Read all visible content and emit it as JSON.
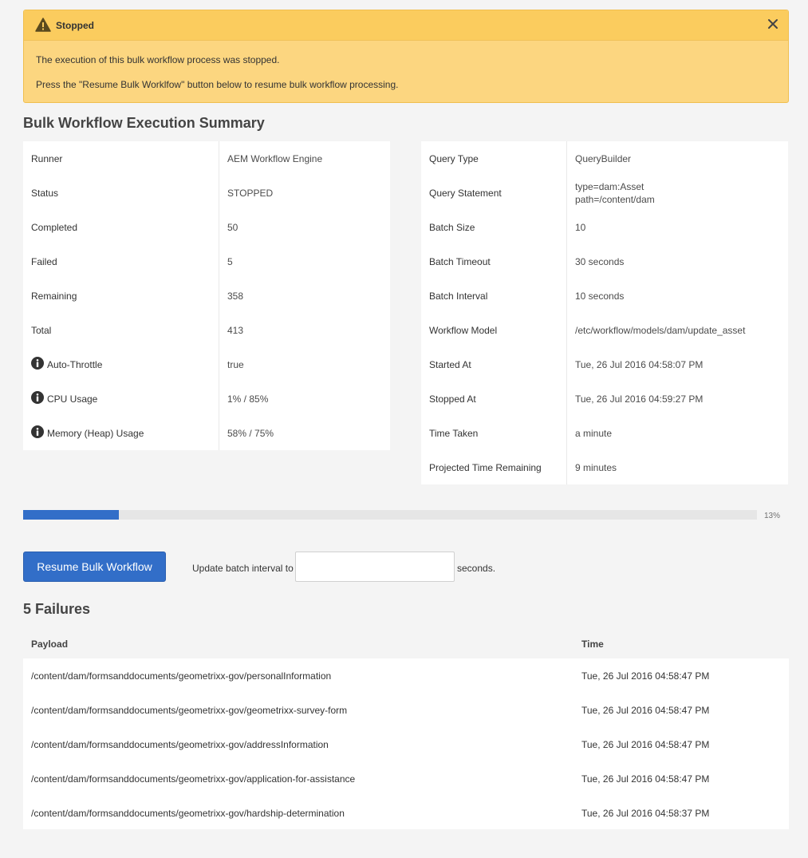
{
  "alert": {
    "title": "Stopped",
    "message1": "The execution of this bulk workflow process was stopped.",
    "message2": "Press the \"Resume Bulk Worklfow\" button below to resume bulk workflow processing.",
    "icon": "warning-icon",
    "close_icon": "close-icon"
  },
  "summary": {
    "heading": "Bulk Workflow Execution Summary",
    "left": [
      {
        "label": "Runner",
        "value": "AEM Workflow Engine"
      },
      {
        "label": "Status",
        "value": "STOPPED"
      },
      {
        "label": "Completed",
        "value": "50"
      },
      {
        "label": "Failed",
        "value": "5"
      },
      {
        "label": "Remaining",
        "value": "358"
      },
      {
        "label": "Total",
        "value": "413"
      },
      {
        "label": "Auto-Throttle",
        "value": "true"
      },
      {
        "label": "CPU Usage",
        "value": "1% / 85%"
      },
      {
        "label": "Memory (Heap) Usage",
        "value": "58% / 75%"
      }
    ],
    "right": [
      {
        "label": "Query Type",
        "value": "QueryBuilder"
      },
      {
        "label": "Query Statement",
        "value": "type=dam:Asset",
        "value2": "path=/content/dam"
      },
      {
        "label": "Batch Size",
        "value": "10"
      },
      {
        "label": "Batch Timeout",
        "value": "30 seconds"
      },
      {
        "label": "Batch Interval",
        "value": "10 seconds"
      },
      {
        "label": "Workflow Model",
        "value": "/etc/workflow/models/dam/update_asset"
      },
      {
        "label": "Started At",
        "value": "Tue, 26 Jul 2016 04:58:07 PM"
      },
      {
        "label": "Stopped At",
        "value": "Tue, 26 Jul 2016 04:59:27 PM"
      },
      {
        "label": "Time Taken",
        "value": "a minute"
      },
      {
        "label": "Projected Time Remaining",
        "value": "9 minutes"
      }
    ]
  },
  "progress": {
    "percent_label": "13%",
    "fraction": 0.13,
    "color": "#326ec8"
  },
  "controls": {
    "resume_button": "Resume Bulk Workflow",
    "interval_label": "Update batch interval to",
    "interval_value": "",
    "interval_suffix": "seconds."
  },
  "failures": {
    "heading": "5 Failures",
    "columns": {
      "payload": "Payload",
      "time": "Time"
    },
    "rows": [
      {
        "payload": "/content/dam/formsanddocuments/geometrixx-gov/personalInformation",
        "time": "Tue, 26 Jul 2016 04:58:47 PM"
      },
      {
        "payload": "/content/dam/formsanddocuments/geometrixx-gov/geometrixx-survey-form",
        "time": "Tue, 26 Jul 2016 04:58:47 PM"
      },
      {
        "payload": "/content/dam/formsanddocuments/geometrixx-gov/addressInformation",
        "time": "Tue, 26 Jul 2016 04:58:47 PM"
      },
      {
        "payload": "/content/dam/formsanddocuments/geometrixx-gov/application-for-assistance",
        "time": "Tue, 26 Jul 2016 04:58:47 PM"
      },
      {
        "payload": "/content/dam/formsanddocuments/geometrixx-gov/hardship-determination",
        "time": "Tue, 26 Jul 2016 04:58:37 PM"
      }
    ]
  }
}
